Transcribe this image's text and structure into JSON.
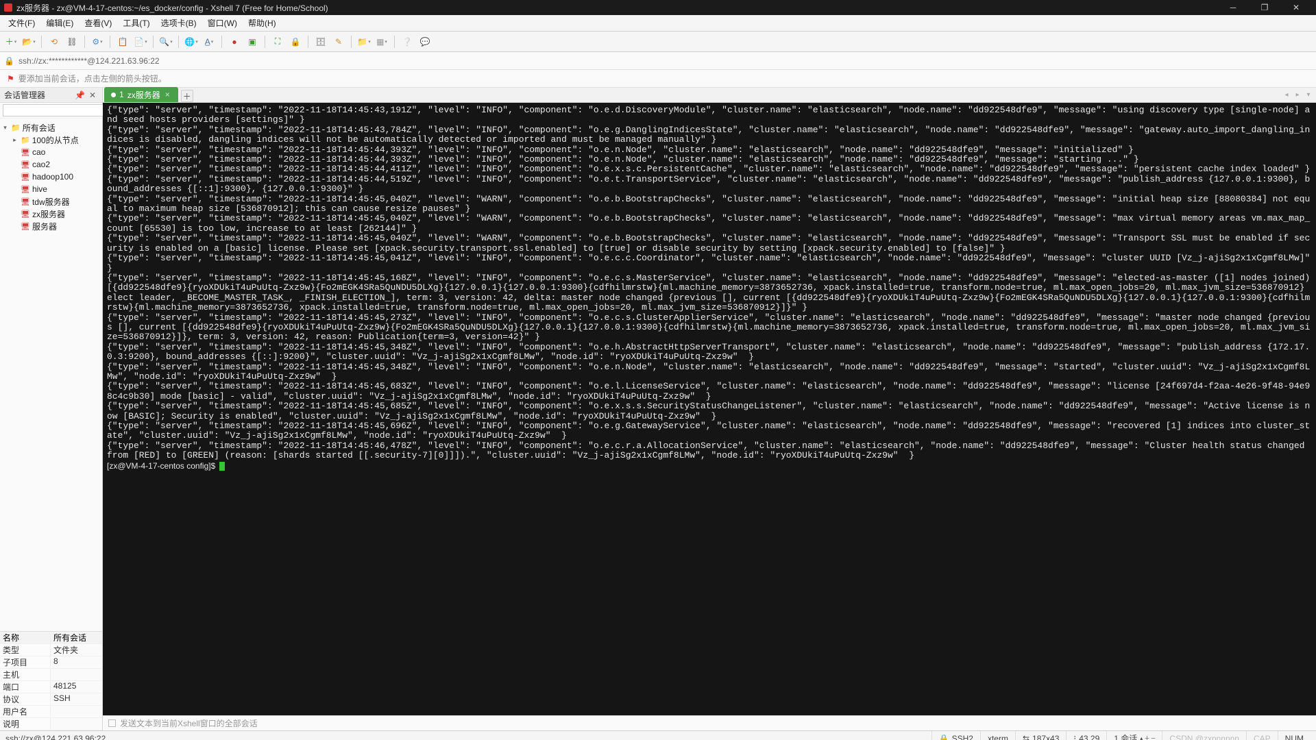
{
  "window": {
    "title": "zx服务器 - zx@VM-4-17-centos:~/es_docker/config - Xshell 7 (Free for Home/School)"
  },
  "menu": [
    "文件(F)",
    "编辑(E)",
    "查看(V)",
    "工具(T)",
    "选项卡(B)",
    "窗口(W)",
    "帮助(H)"
  ],
  "address": "ssh://zx:************@124.221.63.96:22",
  "hint": "要添加当前会话，点击左侧的箭头按钮。",
  "sidebar": {
    "title": "会话管理器",
    "search_placeholder": "",
    "tree": [
      {
        "depth": 0,
        "exp": "▾",
        "icon": "📁",
        "label": "所有会话",
        "folder": true
      },
      {
        "depth": 1,
        "exp": "▸",
        "icon": "📁",
        "label": "100的从节点",
        "folder": true
      },
      {
        "depth": 1,
        "exp": "",
        "icon": "🖥",
        "label": "cao"
      },
      {
        "depth": 1,
        "exp": "",
        "icon": "🖥",
        "label": "cao2"
      },
      {
        "depth": 1,
        "exp": "",
        "icon": "🖥",
        "label": "hadoop100"
      },
      {
        "depth": 1,
        "exp": "",
        "icon": "🖥",
        "label": "hive"
      },
      {
        "depth": 1,
        "exp": "",
        "icon": "🖥",
        "label": "tdw服务器"
      },
      {
        "depth": 1,
        "exp": "",
        "icon": "🖥",
        "label": "zx服务器"
      },
      {
        "depth": 1,
        "exp": "",
        "icon": "🖥",
        "label": "服务器"
      }
    ],
    "props_header": {
      "k": "名称",
      "v": "所有会话"
    },
    "props": [
      {
        "k": "类型",
        "v": "文件夹"
      },
      {
        "k": "子项目",
        "v": "8"
      },
      {
        "k": "主机",
        "v": ""
      },
      {
        "k": "端口",
        "v": "48125"
      },
      {
        "k": "协议",
        "v": "SSH"
      },
      {
        "k": "用户名",
        "v": ""
      },
      {
        "k": "说明",
        "v": ""
      }
    ]
  },
  "tabs": {
    "active_index": "1",
    "active_label": "zx服务器"
  },
  "terminal_lines": [
    "{\"type\": \"server\", \"timestamp\": \"2022-11-18T14:45:43,191Z\", \"level\": \"INFO\", \"component\": \"o.e.d.DiscoveryModule\", \"cluster.name\": \"elasticsearch\", \"node.name\": \"dd922548dfe9\", \"message\": \"using discovery type [single-node] and seed hosts providers [settings]\" }",
    "{\"type\": \"server\", \"timestamp\": \"2022-11-18T14:45:43,784Z\", \"level\": \"INFO\", \"component\": \"o.e.g.DanglingIndicesState\", \"cluster.name\": \"elasticsearch\", \"node.name\": \"dd922548dfe9\", \"message\": \"gateway.auto_import_dangling_indices is disabled, dangling indices will not be automatically detected or imported and must be managed manually\" }",
    "{\"type\": \"server\", \"timestamp\": \"2022-11-18T14:45:44,393Z\", \"level\": \"INFO\", \"component\": \"o.e.n.Node\", \"cluster.name\": \"elasticsearch\", \"node.name\": \"dd922548dfe9\", \"message\": \"initialized\" }",
    "{\"type\": \"server\", \"timestamp\": \"2022-11-18T14:45:44,393Z\", \"level\": \"INFO\", \"component\": \"o.e.n.Node\", \"cluster.name\": \"elasticsearch\", \"node.name\": \"dd922548dfe9\", \"message\": \"starting ...\" }",
    "{\"type\": \"server\", \"timestamp\": \"2022-11-18T14:45:44,411Z\", \"level\": \"INFO\", \"component\": \"o.e.x.s.c.PersistentCache\", \"cluster.name\": \"elasticsearch\", \"node.name\": \"dd922548dfe9\", \"message\": \"persistent cache index loaded\" }",
    "{\"type\": \"server\", \"timestamp\": \"2022-11-18T14:45:44,519Z\", \"level\": \"INFO\", \"component\": \"o.e.t.TransportService\", \"cluster.name\": \"elasticsearch\", \"node.name\": \"dd922548dfe9\", \"message\": \"publish_address {127.0.0.1:9300}, bound_addresses {[::1]:9300}, {127.0.0.1:9300}\" }",
    "{\"type\": \"server\", \"timestamp\": \"2022-11-18T14:45:45,040Z\", \"level\": \"WARN\", \"component\": \"o.e.b.BootstrapChecks\", \"cluster.name\": \"elasticsearch\", \"node.name\": \"dd922548dfe9\", \"message\": \"initial heap size [88080384] not equal to maximum heap size [536870912]; this can cause resize pauses\" }",
    "{\"type\": \"server\", \"timestamp\": \"2022-11-18T14:45:45,040Z\", \"level\": \"WARN\", \"component\": \"o.e.b.BootstrapChecks\", \"cluster.name\": \"elasticsearch\", \"node.name\": \"dd922548dfe9\", \"message\": \"max virtual memory areas vm.max_map_count [65530] is too low, increase to at least [262144]\" }",
    "{\"type\": \"server\", \"timestamp\": \"2022-11-18T14:45:45,040Z\", \"level\": \"WARN\", \"component\": \"o.e.b.BootstrapChecks\", \"cluster.name\": \"elasticsearch\", \"node.name\": \"dd922548dfe9\", \"message\": \"Transport SSL must be enabled if security is enabled on a [basic] license. Please set [xpack.security.transport.ssl.enabled] to [true] or disable security by setting [xpack.security.enabled] to [false]\" }",
    "{\"type\": \"server\", \"timestamp\": \"2022-11-18T14:45:45,041Z\", \"level\": \"INFO\", \"component\": \"o.e.c.c.Coordinator\", \"cluster.name\": \"elasticsearch\", \"node.name\": \"dd922548dfe9\", \"message\": \"cluster UUID [Vz_j-ajiSg2x1xCgmf8LMw]\" }",
    "{\"type\": \"server\", \"timestamp\": \"2022-11-18T14:45:45,168Z\", \"level\": \"INFO\", \"component\": \"o.e.c.s.MasterService\", \"cluster.name\": \"elasticsearch\", \"node.name\": \"dd922548dfe9\", \"message\": \"elected-as-master ([1] nodes joined)[{dd922548dfe9}{ryoXDUkiT4uPuUtq-Zxz9w}{Fo2mEGK4SRa5QuNDU5DLXg}{127.0.0.1}{127.0.0.1:9300}{cdfhilmrstw}{ml.machine_memory=3873652736, xpack.installed=true, transform.node=true, ml.max_open_jobs=20, ml.max_jvm_size=536870912} elect leader, _BECOME_MASTER_TASK_, _FINISH_ELECTION_], term: 3, version: 42, delta: master node changed {previous [], current [{dd922548dfe9}{ryoXDUkiT4uPuUtq-Zxz9w}{Fo2mEGK4SRa5QuNDU5DLXg}{127.0.0.1}{127.0.0.1:9300}{cdfhilmrstw}{ml.machine_memory=3873652736, xpack.installed=true, transform.node=true, ml.max_open_jobs=20, ml.max_jvm_size=536870912}]}\" }",
    "{\"type\": \"server\", \"timestamp\": \"2022-11-18T14:45:45,273Z\", \"level\": \"INFO\", \"component\": \"o.e.c.s.ClusterApplierService\", \"cluster.name\": \"elasticsearch\", \"node.name\": \"dd922548dfe9\", \"message\": \"master node changed {previous [], current [{dd922548dfe9}{ryoXDUkiT4uPuUtq-Zxz9w}{Fo2mEGK4SRa5QuNDU5DLXg}{127.0.0.1}{127.0.0.1:9300}{cdfhilmrstw}{ml.machine_memory=3873652736, xpack.installed=true, transform.node=true, ml.max_open_jobs=20, ml.max_jvm_size=536870912}]}, term: 3, version: 42, reason: Publication{term=3, version=42}\" }",
    "{\"type\": \"server\", \"timestamp\": \"2022-11-18T14:45:45,348Z\", \"level\": \"INFO\", \"component\": \"o.e.h.AbstractHttpServerTransport\", \"cluster.name\": \"elasticsearch\", \"node.name\": \"dd922548dfe9\", \"message\": \"publish_address {172.17.0.3:9200}, bound_addresses {[::]:9200}\", \"cluster.uuid\": \"Vz_j-ajiSg2x1xCgmf8LMw\", \"node.id\": \"ryoXDUkiT4uPuUtq-Zxz9w\"  }",
    "{\"type\": \"server\", \"timestamp\": \"2022-11-18T14:45:45,348Z\", \"level\": \"INFO\", \"component\": \"o.e.n.Node\", \"cluster.name\": \"elasticsearch\", \"node.name\": \"dd922548dfe9\", \"message\": \"started\", \"cluster.uuid\": \"Vz_j-ajiSg2x1xCgmf8LMw\", \"node.id\": \"ryoXDUkiT4uPuUtq-Zxz9w\"  }",
    "{\"type\": \"server\", \"timestamp\": \"2022-11-18T14:45:45,683Z\", \"level\": \"INFO\", \"component\": \"o.e.l.LicenseService\", \"cluster.name\": \"elasticsearch\", \"node.name\": \"dd922548dfe9\", \"message\": \"license [24f697d4-f2aa-4e26-9f48-94e98c4c9b30] mode [basic] - valid\", \"cluster.uuid\": \"Vz_j-ajiSg2x1xCgmf8LMw\", \"node.id\": \"ryoXDUkiT4uPuUtq-Zxz9w\"  }",
    "{\"type\": \"server\", \"timestamp\": \"2022-11-18T14:45:45,685Z\", \"level\": \"INFO\", \"component\": \"o.e.x.s.s.SecurityStatusChangeListener\", \"cluster.name\": \"elasticsearch\", \"node.name\": \"dd922548dfe9\", \"message\": \"Active license is now [BASIC]; Security is enabled\", \"cluster.uuid\": \"Vz_j-ajiSg2x1xCgmf8LMw\", \"node.id\": \"ryoXDUkiT4uPuUtq-Zxz9w\"  }",
    "{\"type\": \"server\", \"timestamp\": \"2022-11-18T14:45:45,696Z\", \"level\": \"INFO\", \"component\": \"o.e.g.GatewayService\", \"cluster.name\": \"elasticsearch\", \"node.name\": \"dd922548dfe9\", \"message\": \"recovered [1] indices into cluster_state\", \"cluster.uuid\": \"Vz_j-ajiSg2x1xCgmf8LMw\", \"node.id\": \"ryoXDUkiT4uPuUtq-Zxz9w\"  }",
    "{\"type\": \"server\", \"timestamp\": \"2022-11-18T14:45:46,478Z\", \"level\": \"INFO\", \"component\": \"o.e.c.r.a.AllocationService\", \"cluster.name\": \"elasticsearch\", \"node.name\": \"dd922548dfe9\", \"message\": \"Cluster health status changed from [RED] to [GREEN] (reason: [shards started [[.security-7][0]]]).\", \"cluster.uuid\": \"Vz_j-ajiSg2x1xCgmf8LMw\", \"node.id\": \"ryoXDUkiT4uPuUtq-Zxz9w\"  }"
  ],
  "prompt": "[zx@VM-4-17-centos config]$ ",
  "inputbar_placeholder": "发送文本到当前Xshell窗口的全部会话",
  "status": {
    "conn": "ssh://zx@124.221.63.96:22",
    "ssh": "SSH2",
    "term": "xterm",
    "size": "187x43",
    "cursor": "43,29",
    "sessions": "1 会话",
    "cap": "CAP",
    "num": "NUM",
    "watermark": "CSDN @zxpnnnnn"
  }
}
